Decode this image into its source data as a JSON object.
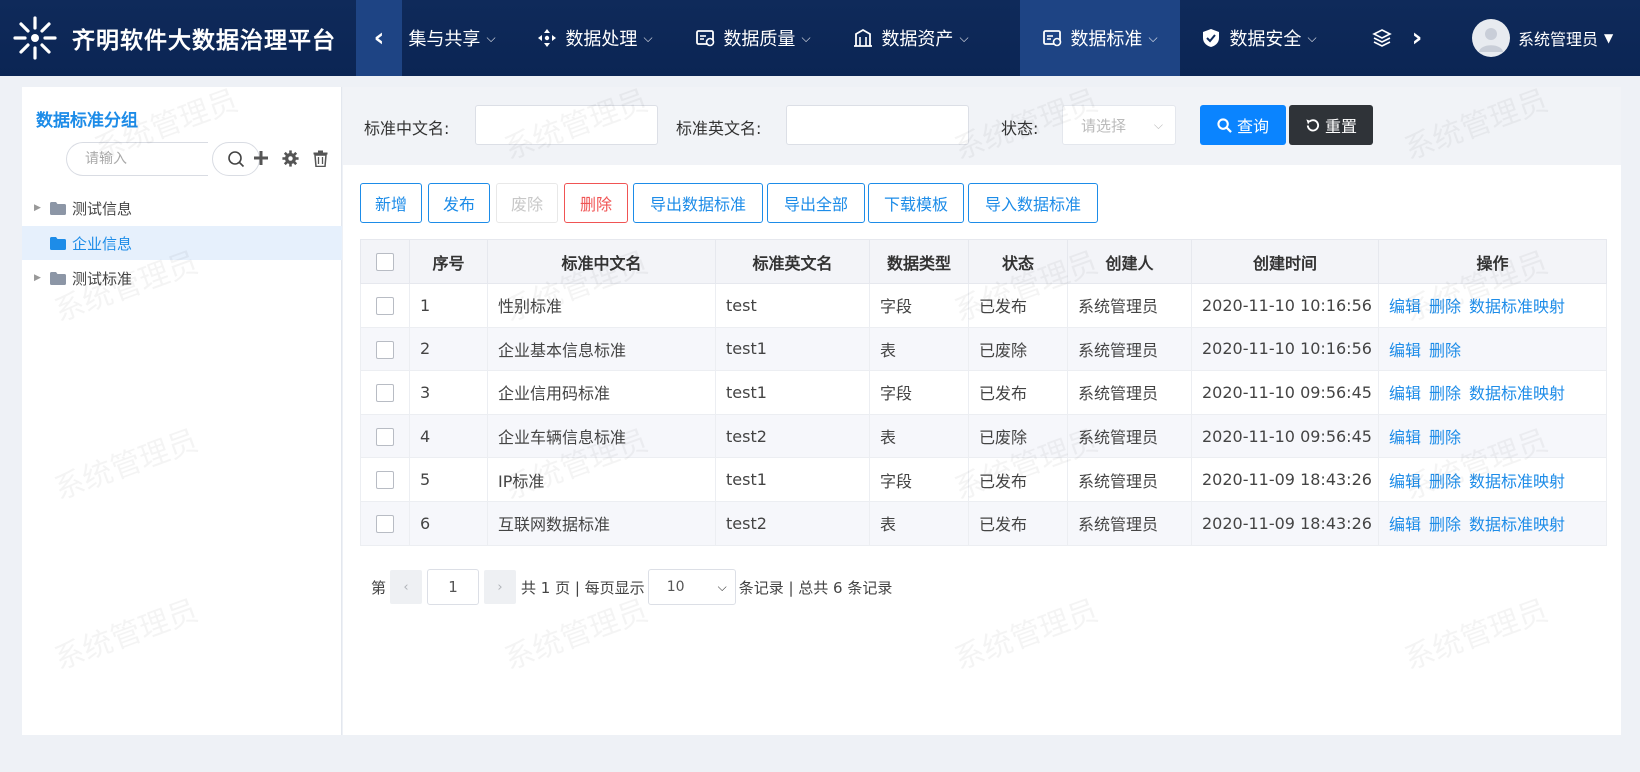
{
  "app": {
    "title": "齐明软件大数据治理平台"
  },
  "nav": {
    "items": [
      {
        "label": "集与共享",
        "icon": "share-icon"
      },
      {
        "label": "数据处理",
        "icon": "process-icon"
      },
      {
        "label": "数据质量",
        "icon": "quality-icon"
      },
      {
        "label": "数据资产",
        "icon": "asset-icon"
      },
      {
        "label": "数据标准",
        "icon": "standard-icon",
        "active": true
      },
      {
        "label": "数据安全",
        "icon": "shield-icon"
      }
    ],
    "prev_glyph": "‹",
    "next_glyph": "›"
  },
  "user": {
    "name": "系统管理员"
  },
  "left_panel": {
    "title": "数据标准分组",
    "search_placeholder": "请输入",
    "tree": [
      {
        "label": "测试信息",
        "expandable": true
      },
      {
        "label": "企业信息",
        "selected": true
      },
      {
        "label": "测试标准",
        "expandable": true
      }
    ]
  },
  "filters": {
    "cn_name_label": "标准中文名:",
    "en_name_label": "标准英文名:",
    "status_label": "状态:",
    "status_placeholder": "请选择",
    "query_label": "查询",
    "reset_label": "重置"
  },
  "actions": {
    "add": "新增",
    "publish": "发布",
    "abolish": "废除",
    "delete": "删除",
    "export_standard": "导出数据标准",
    "export_all": "导出全部",
    "download_template": "下载模板",
    "import_standard": "导入数据标准"
  },
  "table": {
    "headers": [
      "序号",
      "标准中文名",
      "标准英文名",
      "数据类型",
      "状态",
      "创建人",
      "创建时间",
      "操作"
    ],
    "rows": [
      {
        "no": "1",
        "cn": "性别标准",
        "en": "test",
        "type": "字段",
        "status": "已发布",
        "creator": "系统管理员",
        "time": "2020-11-10 10:16:56",
        "ops": [
          "编辑",
          "删除",
          "数据标准映射"
        ]
      },
      {
        "no": "2",
        "cn": "企业基本信息标准",
        "en": "test1",
        "type": "表",
        "status": "已废除",
        "creator": "系统管理员",
        "time": "2020-11-10 10:16:56",
        "ops": [
          "编辑",
          "删除"
        ]
      },
      {
        "no": "3",
        "cn": "企业信用码标准",
        "en": "test1",
        "type": "字段",
        "status": "已发布",
        "creator": "系统管理员",
        "time": "2020-11-10 09:56:45",
        "ops": [
          "编辑",
          "删除",
          "数据标准映射"
        ]
      },
      {
        "no": "4",
        "cn": "企业车辆信息标准",
        "en": "test2",
        "type": "表",
        "status": "已废除",
        "creator": "系统管理员",
        "time": "2020-11-10 09:56:45",
        "ops": [
          "编辑",
          "删除"
        ]
      },
      {
        "no": "5",
        "cn": "IP标准",
        "en": "test1",
        "type": "字段",
        "status": "已发布",
        "creator": "系统管理员",
        "time": "2020-11-09 18:43:26",
        "ops": [
          "编辑",
          "删除",
          "数据标准映射"
        ]
      },
      {
        "no": "6",
        "cn": "互联网数据标准",
        "en": "test2",
        "type": "表",
        "status": "已发布",
        "creator": "系统管理员",
        "time": "2020-11-09 18:43:26",
        "ops": [
          "编辑",
          "删除",
          "数据标准映射"
        ]
      }
    ]
  },
  "pager": {
    "prefix": "第",
    "current_page": "1",
    "total_pages_text": "共 1 页 | 每页显示",
    "page_size": "10",
    "records_text": "条记录 | 总共 6 条记录"
  },
  "watermark": "系统管理员",
  "colors": {
    "nav_bg": "#0f2a5a",
    "nav_active": "#1e4484",
    "accent": "#1d8ce8",
    "danger": "#f05454"
  }
}
